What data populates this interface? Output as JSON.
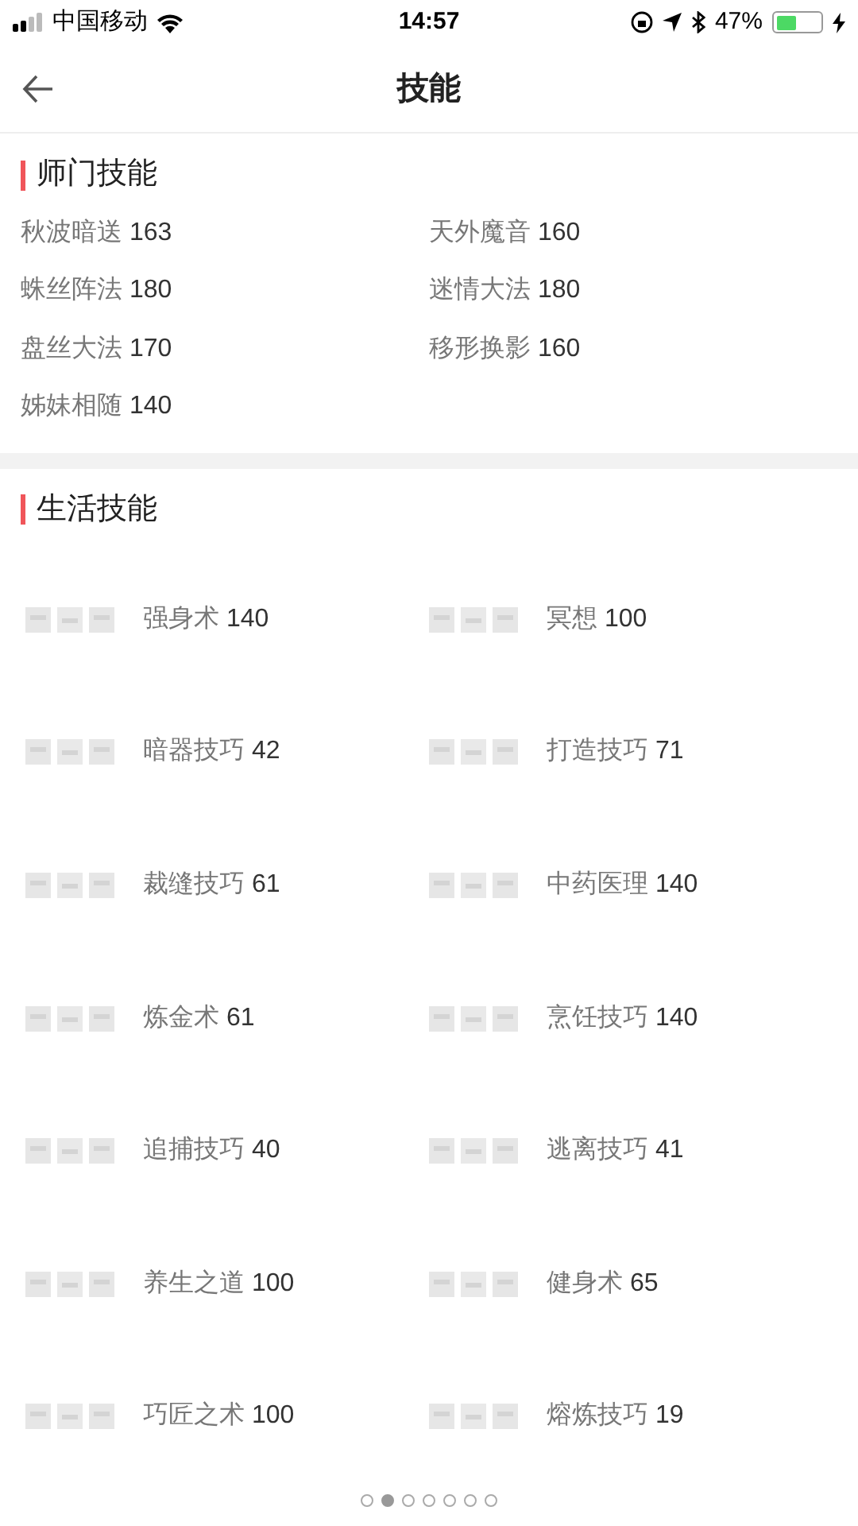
{
  "status_bar": {
    "carrier": "中国移动",
    "time": "14:57",
    "battery": "47%"
  },
  "nav": {
    "title": "技能"
  },
  "sections": [
    {
      "title": "师门技能",
      "kind": "text",
      "skills": [
        {
          "name": "秋波暗送",
          "value": "163"
        },
        {
          "name": "天外魔音",
          "value": "160"
        },
        {
          "name": "蛛丝阵法",
          "value": "180"
        },
        {
          "name": "迷情大法",
          "value": "180"
        },
        {
          "name": "盘丝大法",
          "value": "170"
        },
        {
          "name": "移形换影",
          "value": "160"
        },
        {
          "name": "姊妹相随",
          "value": "140"
        }
      ]
    },
    {
      "title": "生活技能",
      "kind": "icon",
      "skills": [
        {
          "name": "强身术",
          "value": "140"
        },
        {
          "name": "冥想",
          "value": "100"
        },
        {
          "name": "暗器技巧",
          "value": "42"
        },
        {
          "name": "打造技巧",
          "value": "71"
        },
        {
          "name": "裁缝技巧",
          "value": "61"
        },
        {
          "name": "中药医理",
          "value": "140"
        },
        {
          "name": "炼金术",
          "value": "61"
        },
        {
          "name": "烹饪技巧",
          "value": "140"
        },
        {
          "name": "追捕技巧",
          "value": "40"
        },
        {
          "name": "逃离技巧",
          "value": "41"
        },
        {
          "name": "养生之道",
          "value": "100"
        },
        {
          "name": "健身术",
          "value": "65"
        },
        {
          "name": "巧匠之术",
          "value": "100"
        },
        {
          "name": "熔炼技巧",
          "value": "19"
        }
      ]
    }
  ],
  "pager": [
    {
      "selected": false
    },
    {
      "selected": true
    },
    {
      "selected": false
    },
    {
      "selected": false
    },
    {
      "selected": false
    },
    {
      "selected": false
    },
    {
      "selected": false
    }
  ]
}
